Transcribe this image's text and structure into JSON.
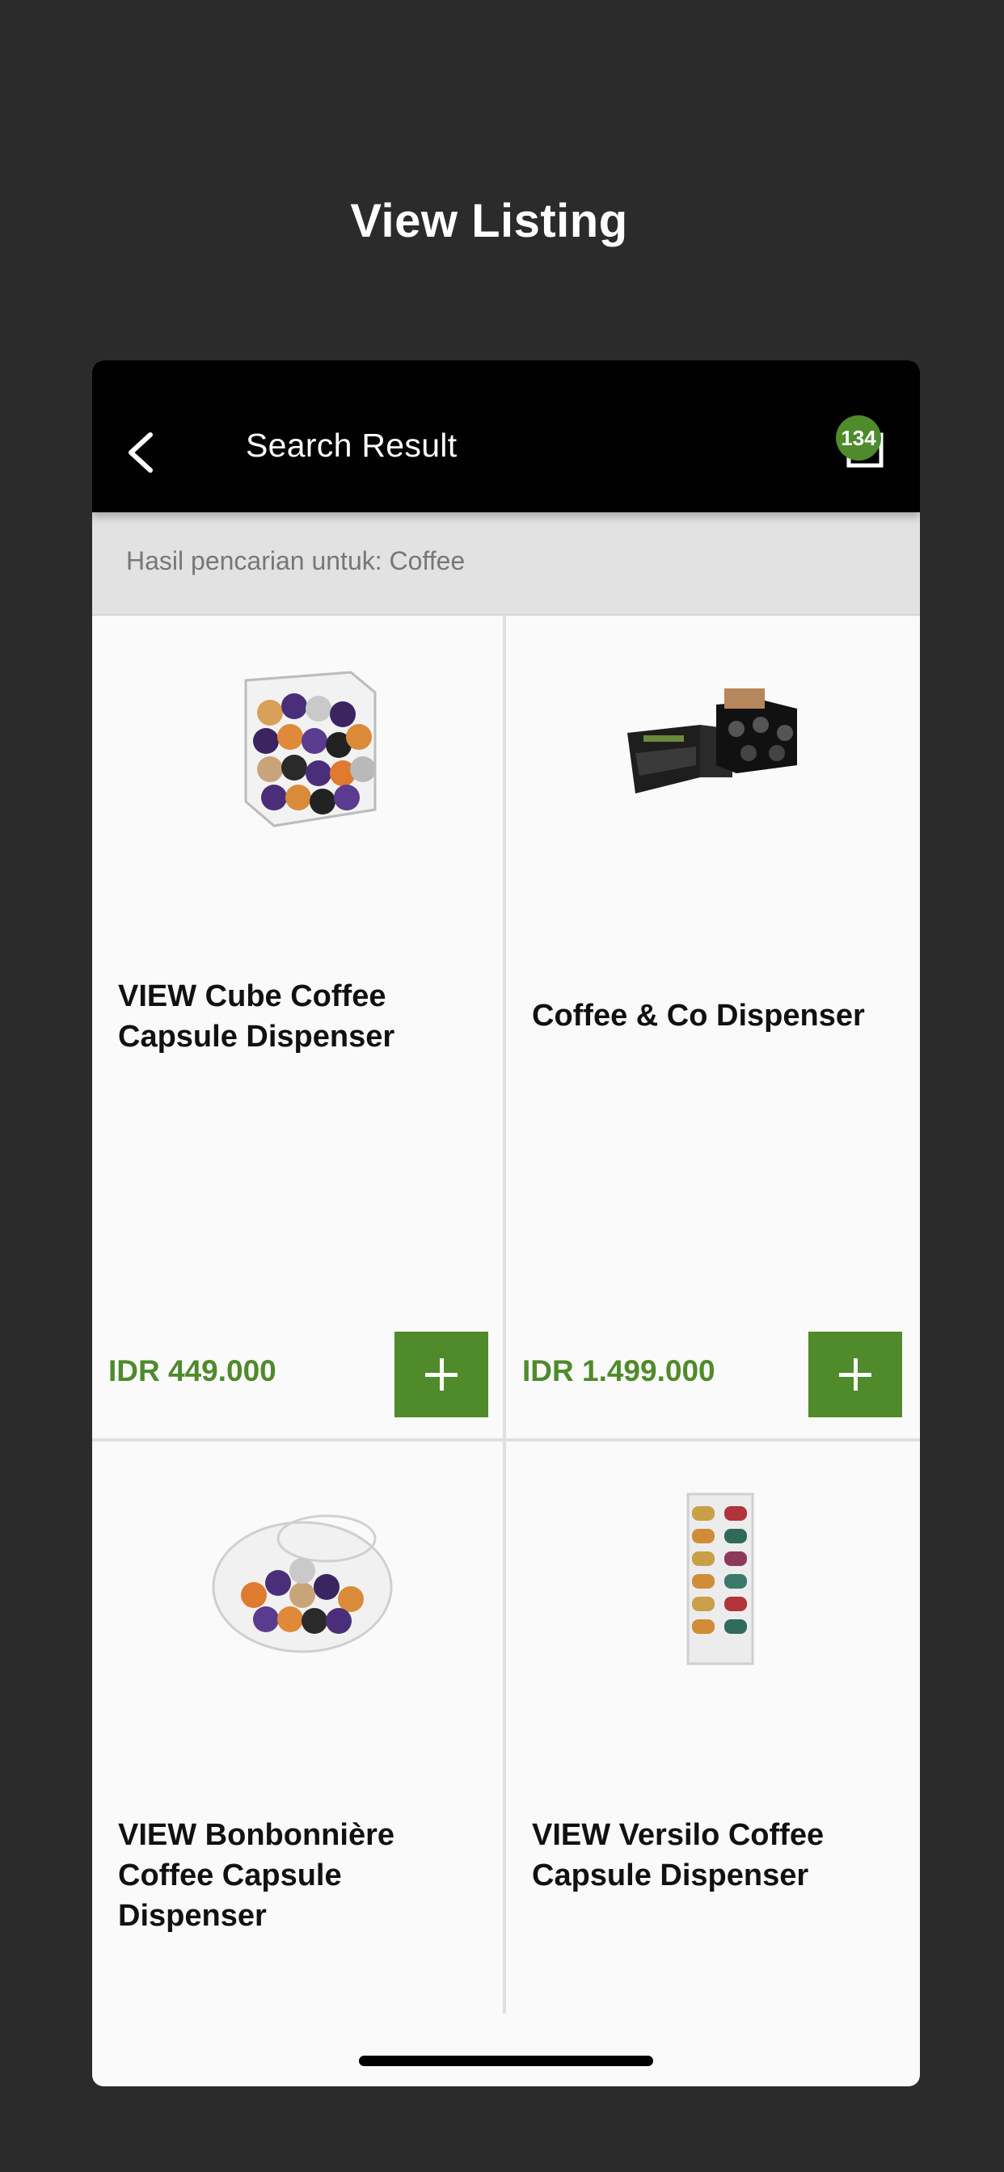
{
  "page": {
    "title": "View Listing"
  },
  "header": {
    "title": "Search Result",
    "back_icon": "chevron-left-icon",
    "basket_icon": "basket-icon",
    "basket_count": "134"
  },
  "search": {
    "result_text": "Hasil pencarian untuk: Coffee"
  },
  "products": [
    {
      "name": "VIEW Cube Coffee Capsule Dispenser",
      "price": "IDR 449.000",
      "add_icon": "plus-icon"
    },
    {
      "name": "Coffee & Co Dispenser",
      "price": "IDR 1.499.000",
      "add_icon": "plus-icon"
    },
    {
      "name": "VIEW Bonbonnière Coffee Capsule Dispenser",
      "price": "",
      "add_icon": "plus-icon"
    },
    {
      "name": "VIEW Versilo Coffee Capsule Dispenser",
      "price": "",
      "add_icon": "plus-icon"
    }
  ],
  "colors": {
    "accent": "#4f8a2b",
    "header_bg": "#000000",
    "background": "#2b2b2b"
  }
}
